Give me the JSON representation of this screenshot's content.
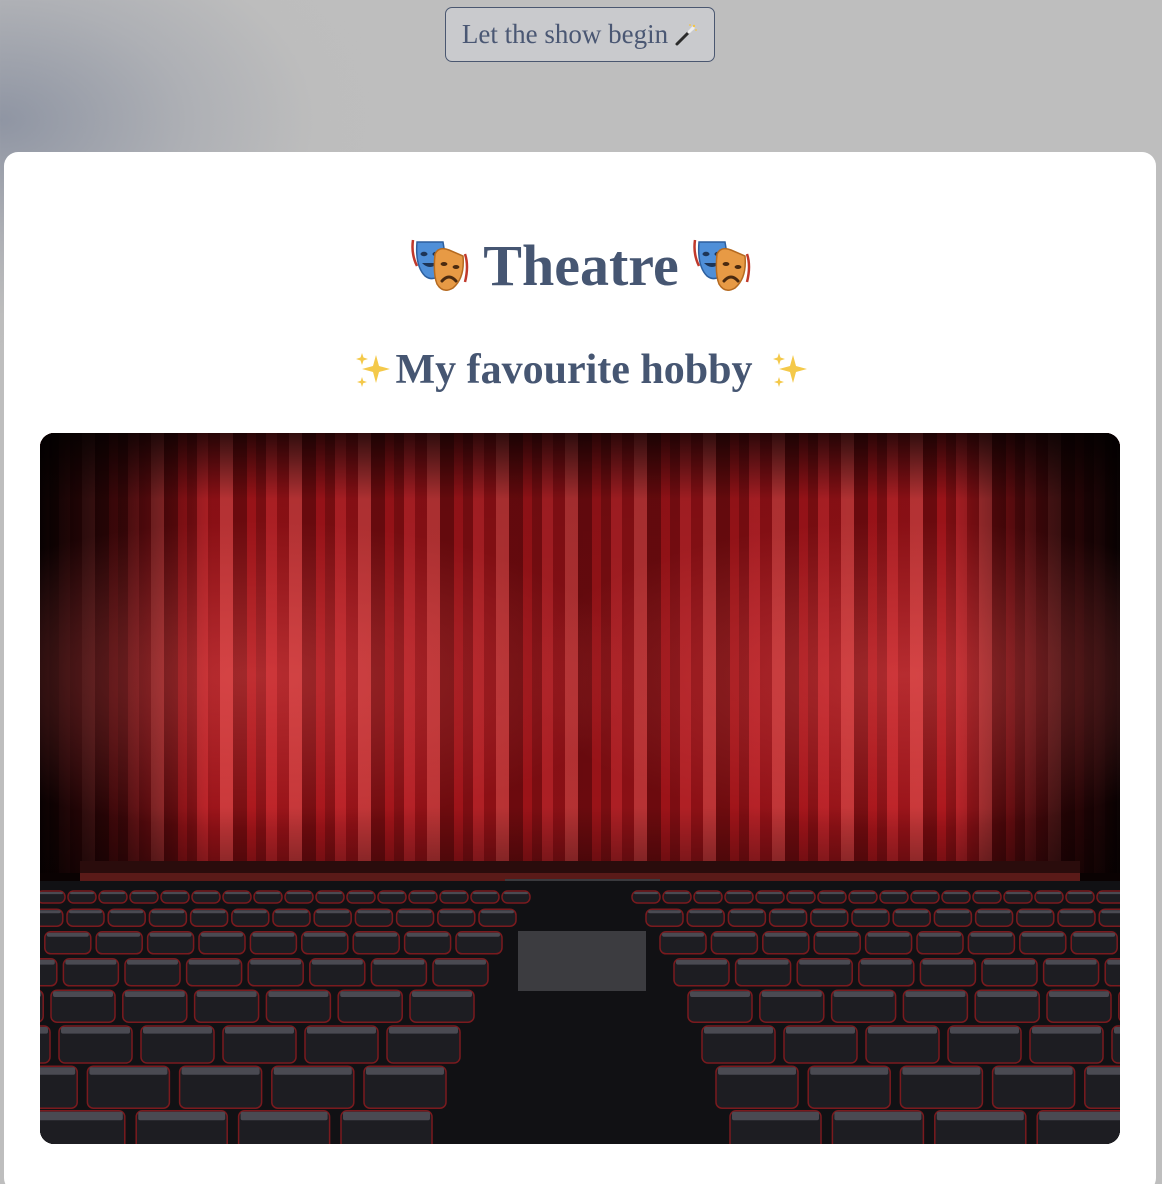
{
  "header": {
    "button_label": "Let the show begin",
    "button_icon": "magic-wand-icon"
  },
  "main": {
    "title": "Theatre",
    "title_icon": "performing-arts-masks-icon",
    "subtitle": "My favourite hobby",
    "subtitle_icon": "sparkles-icon",
    "image": {
      "icon": "theatre-stage-photo",
      "description_visible": false
    }
  },
  "colors": {
    "text": "#465672",
    "card": "#ffffff",
    "background": "#bebebe",
    "curtain": "#b3161c"
  }
}
